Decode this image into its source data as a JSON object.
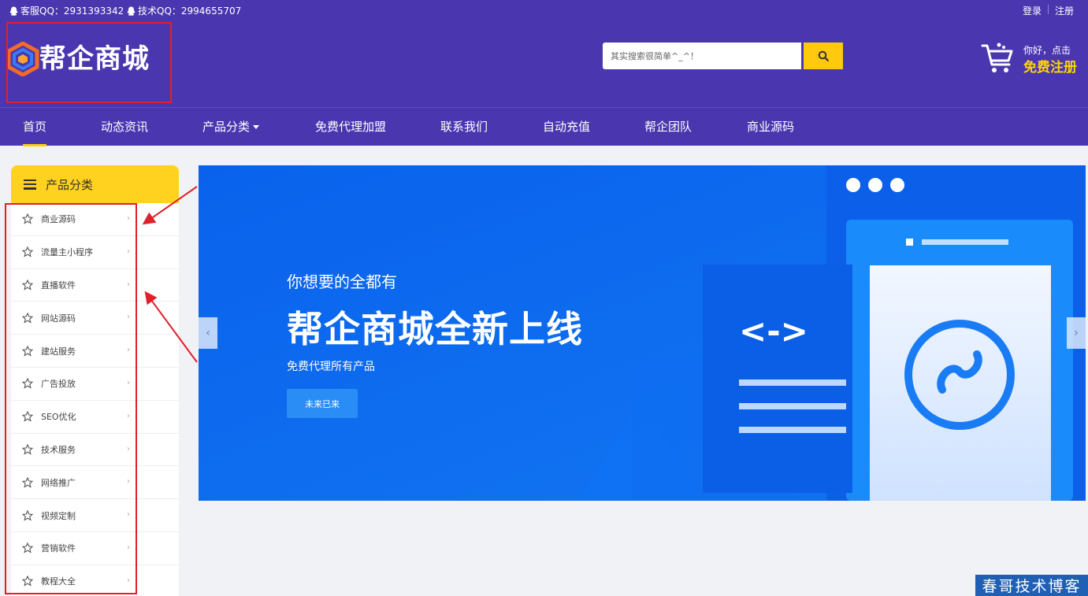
{
  "topbar": {
    "service_qq": "客服QQ：2931393342",
    "tech_qq": "技术QQ：2994655707",
    "login": "登录",
    "register": "注册"
  },
  "header": {
    "logo_text": "帮企商城",
    "search_placeholder": "其实搜索很简单^_^！",
    "greeting": "你好，点击",
    "register_cta": "免费注册"
  },
  "nav": {
    "items": [
      "首页",
      "动态资讯",
      "产品分类",
      "免费代理加盟",
      "联系我们",
      "自动充值",
      "帮企团队",
      "商业源码"
    ]
  },
  "sidebar": {
    "title": "产品分类",
    "items": [
      "商业源码",
      "流量主小程序",
      "直播软件",
      "网站源码",
      "建站服务",
      "广告投放",
      "SEO优化",
      "技术服务",
      "网络推广",
      "视频定制",
      "营销软件",
      "教程大全"
    ]
  },
  "banner": {
    "subtitle": "你想要的全都有",
    "headline": "帮企商城全新上线",
    "description": "免费代理所有产品",
    "cta": "未来已来",
    "code_glyph": "<->"
  },
  "watermark": "春哥技术博客",
  "colors": {
    "brand_purple": "#4a37b0",
    "accent_yellow": "#ffd21f",
    "banner_blue": "#0c68ef",
    "annotation_red": "#e0202a"
  }
}
